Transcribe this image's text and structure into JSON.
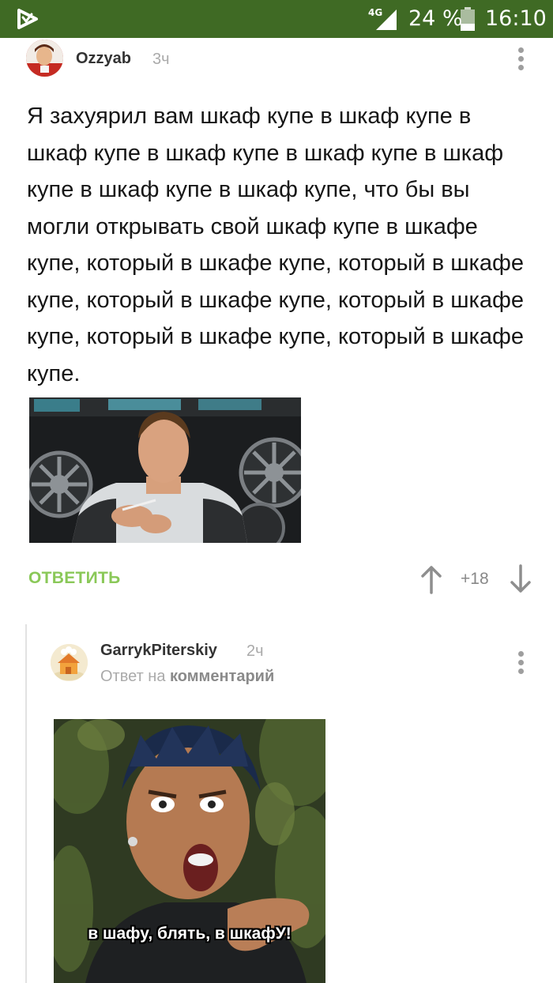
{
  "status_bar": {
    "network": "4G",
    "battery_percent": "24 %",
    "time": "16:10",
    "color": "#3f6a24"
  },
  "comment": {
    "author": "Ozzyab",
    "time": "3ч",
    "text": "Я захуярил вам шкаф купе в шкаф купе в шкаф купе в шкаф купе в шкаф купе в шкаф купе в шкаф купе в шкаф купе, что бы вы могли открывать свой шкаф купе в шкафе купе, который в шкафе купе, который в шкафе купе, который в шкафе купе, который в шкафе купе, который в шкафе купе, который в шкафе купе.",
    "reply_label": "ОТВЕТИТЬ",
    "rating": "+18",
    "accent": "#8ac858"
  },
  "reply": {
    "author": "GarrykPiterskiy",
    "time": "2ч",
    "reply_to_prefix": "Ответ на",
    "reply_to_target": "комментарий",
    "image_caption": "в шафу, блять, в шкафУ!"
  },
  "icons": {
    "app_logo": "pikabu-logo-icon",
    "signal": "signal-icon",
    "battery": "battery-icon",
    "more": "more-vert-icon",
    "upvote": "arrow-up-icon",
    "downvote": "arrow-down-icon"
  }
}
